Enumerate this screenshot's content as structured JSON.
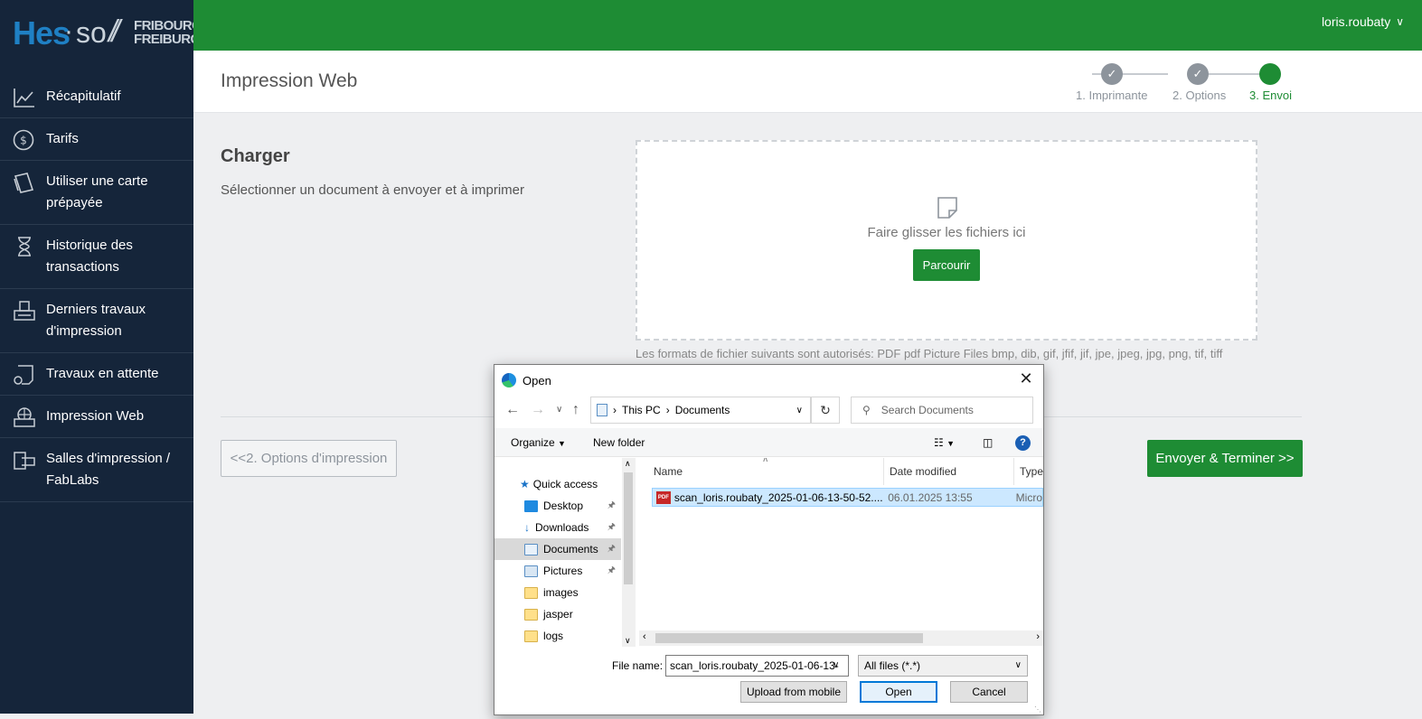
{
  "brand": {
    "logo_hes": "Hes",
    "logo_so": "so",
    "logo_city_1": "FRIBOURG",
    "logo_city_2": "FREIBURG",
    "primary_color": "#1e8c34",
    "sidebar_color": "#15253a"
  },
  "topbar": {
    "user": "loris.roubaty"
  },
  "sidebar": {
    "items": [
      {
        "label": "Récapitulatif",
        "icon": "chart-line-icon"
      },
      {
        "label": "Tarifs",
        "icon": "dollar-circle-icon"
      },
      {
        "label": "Utiliser une carte prépayée",
        "icon": "card-icon"
      },
      {
        "label": "Historique des transactions",
        "icon": "hourglass-icon"
      },
      {
        "label": "Derniers travaux d'impression",
        "icon": "printer-tray-icon"
      },
      {
        "label": "Travaux en attente",
        "icon": "pending-doc-icon"
      },
      {
        "label": "Impression Web",
        "icon": "web-print-icon"
      },
      {
        "label": "Salles d'impression / FabLabs",
        "icon": "room-print-icon"
      }
    ]
  },
  "header": {
    "title": "Impression Web",
    "steps": [
      {
        "label": "1. Imprimante",
        "state": "done"
      },
      {
        "label": "2. Options",
        "state": "done"
      },
      {
        "label": "3. Envoi",
        "state": "active"
      }
    ]
  },
  "main": {
    "section_title": "Charger",
    "section_desc": "Sélectionner un document à envoyer et à imprimer",
    "drop_text": "Faire glisser les fichiers ici",
    "browse_label": "Parcourir",
    "formats": "Les formats de fichier suivants sont autorisés: PDF pdf Picture Files bmp, dib, gif, jfif, jif, jpe, jpeg, jpg, png, tif, tiff",
    "prev_label": "<<2. Options d'impression",
    "next_label": "Envoyer & Terminer >>"
  },
  "dialog": {
    "title": "Open",
    "path": [
      "This PC",
      "Documents"
    ],
    "search_placeholder": "Search Documents",
    "organize": "Organize",
    "new_folder": "New folder",
    "tree": [
      {
        "label": "Quick access",
        "pinned": false
      },
      {
        "label": "Desktop",
        "pinned": true
      },
      {
        "label": "Downloads",
        "pinned": true
      },
      {
        "label": "Documents",
        "pinned": true
      },
      {
        "label": "Pictures",
        "pinned": true
      },
      {
        "label": "images",
        "pinned": false
      },
      {
        "label": "jasper",
        "pinned": false
      },
      {
        "label": "logs",
        "pinned": false
      }
    ],
    "columns": [
      "Name",
      "Date modified",
      "Type"
    ],
    "files": [
      {
        "name": "scan_loris.roubaty_2025-01-06-13-50-52....",
        "date": "06.01.2025 13:55",
        "type": "Micro"
      }
    ],
    "file_name_label": "File name:",
    "file_name_value": "scan_loris.roubaty_2025-01-06-13-",
    "file_type": "All files (*.*)",
    "upload_mobile": "Upload from mobile",
    "open": "Open",
    "cancel": "Cancel"
  }
}
